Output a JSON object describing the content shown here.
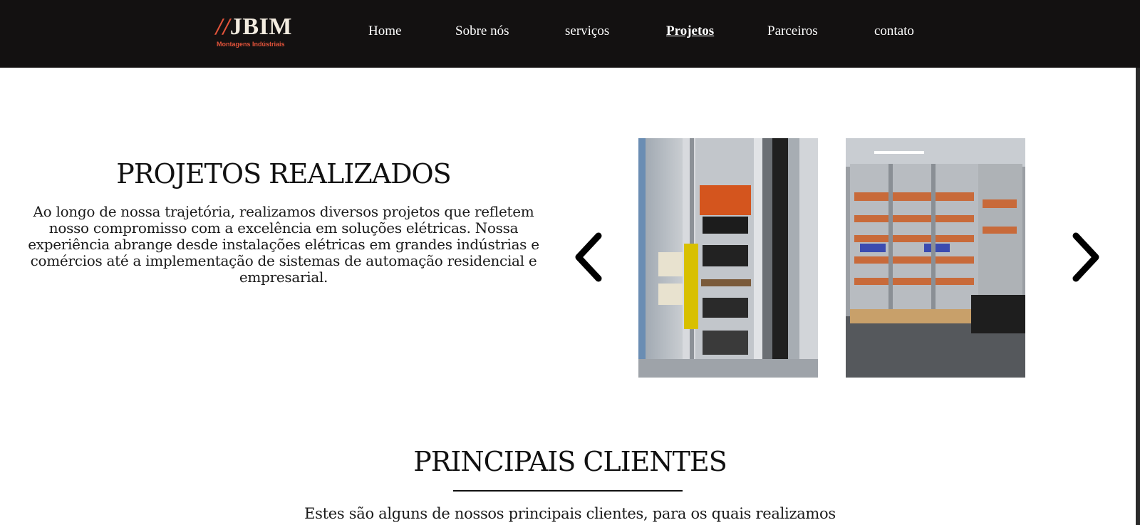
{
  "header": {
    "logo": {
      "mark_slashes": "//",
      "mark_name": "JBIM",
      "subtitle": "Montagens Indústriais"
    },
    "nav": [
      {
        "label": "Home",
        "active": false
      },
      {
        "label": "Sobre nós",
        "active": false
      },
      {
        "label": "serviços",
        "active": false
      },
      {
        "label": "Projetos",
        "active": true
      },
      {
        "label": "Parceiros",
        "active": false
      },
      {
        "label": "contato",
        "active": false
      }
    ]
  },
  "projects": {
    "title": "PROJETOS REALIZADOS",
    "description": "Ao longo de nossa trajetória, realizamos diversos projetos que refletem nosso compromisso com a excelência em soluções elétricas. Nossa experiência abrange desde instalações elétricas em grandes indústrias e comércios até a implementação de sistemas de automação residencial e empresarial.",
    "carousel": {
      "prev_icon": "chevron-left-icon",
      "next_icon": "chevron-right-icon"
    }
  },
  "clients": {
    "title": "PRINCIPAIS CLIENTES",
    "description": "Estes são alguns de nossos principais clientes, para os quais realizamos"
  },
  "colors": {
    "nav_bg": "#131111",
    "logo_accent": "#e2533a",
    "logo_cream": "#f3ece0",
    "text": "#1a1a1a"
  }
}
